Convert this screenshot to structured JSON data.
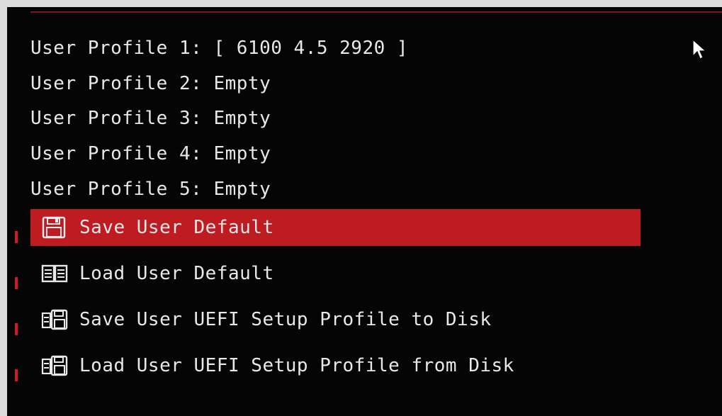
{
  "profiles": [
    {
      "label": "User Profile 1:",
      "value": "[ 6100 4.5 2920 ]"
    },
    {
      "label": "User Profile 2:",
      "value": "Empty"
    },
    {
      "label": "User Profile 3:",
      "value": "Empty"
    },
    {
      "label": "User Profile 4:",
      "value": "Empty"
    },
    {
      "label": "User Profile 5:",
      "value": "Empty"
    }
  ],
  "menu": [
    {
      "label": "Save User Default",
      "icon": "floppy-disk-icon",
      "selected": true
    },
    {
      "label": "Load User Default",
      "icon": "book-icon",
      "selected": false
    },
    {
      "label": "Save User UEFI Setup Profile to Disk",
      "icon": "disk-save-icon",
      "selected": false
    },
    {
      "label": "Load User UEFI Setup Profile from Disk",
      "icon": "disk-load-icon",
      "selected": false
    }
  ],
  "colors": {
    "accent": "#bf1c22",
    "background": "#050505",
    "text": "#e8e8e8",
    "frame": "#dcdcdc"
  }
}
